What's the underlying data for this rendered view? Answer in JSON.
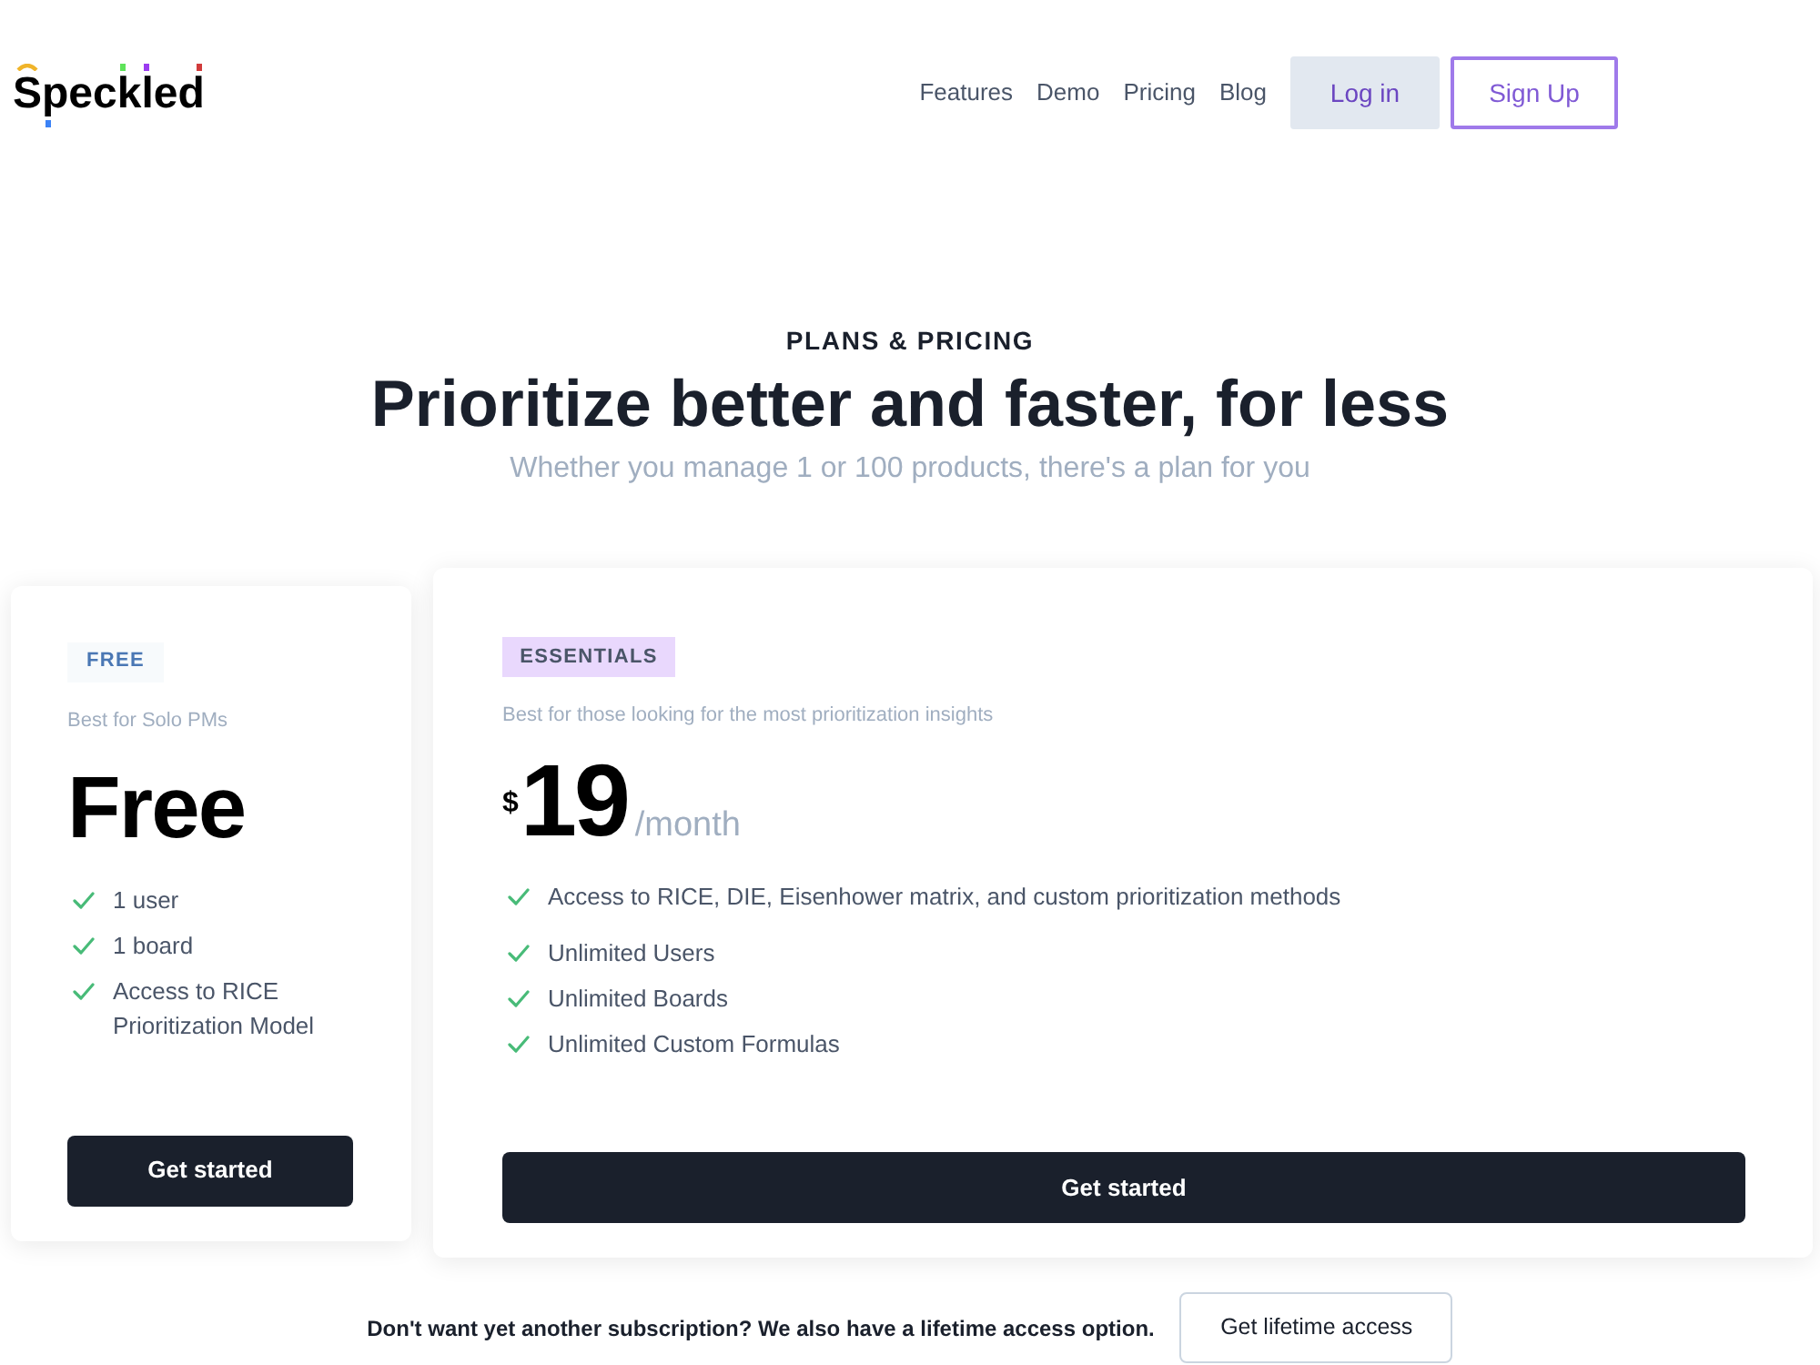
{
  "nav": {
    "logo": "Speckled",
    "links": [
      "Features",
      "Demo",
      "Pricing",
      "Blog"
    ],
    "buttons": [
      {
        "label": "Log in",
        "kind": "secondary"
      },
      {
        "label": "Sign Up",
        "kind": "outline"
      }
    ]
  },
  "hero": {
    "eyebrow": "PLANS & PRICING",
    "title": "Prioritize better and faster, for less",
    "subtitle": "Whether you manage 1 or 100 products, there's a plan for you"
  },
  "plans": [
    {
      "kind": "free",
      "badge": "FREE",
      "tagline": "Best for Solo PMs",
      "price": "Free",
      "features": [
        "1 user",
        "1 board",
        "Access to RICE Prioritization Model"
      ],
      "button": "Get started"
    },
    {
      "kind": "paid",
      "badge": "ESSENTIALS",
      "tagline": "Best for those looking for the most prioritization insights",
      "currency": "$",
      "price": "19",
      "period": "/month",
      "features": [
        "Access to RICE, DIE, Eisenhower matrix, and custom prioritization methods",
        "Unlimited Users",
        "Unlimited Boards",
        "Unlimited Custom Formulas"
      ],
      "button": "Get started"
    }
  ],
  "lifetime": {
    "text": "Don't want yet another subscription? We also have a lifetime access option.",
    "button": "Get lifetime access"
  }
}
